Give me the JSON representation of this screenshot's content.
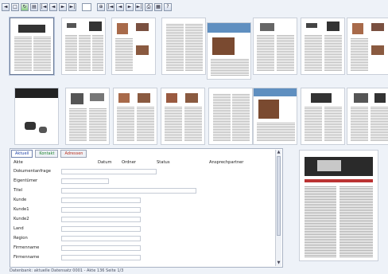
{
  "toolbar": {
    "buttons": [
      {
        "name": "back-icon",
        "glyph": "◄"
      },
      {
        "name": "page-icon",
        "glyph": "□"
      },
      {
        "name": "refresh-icon",
        "glyph": "↻"
      },
      {
        "name": "save-icon",
        "glyph": "▤"
      },
      {
        "name": "first-icon",
        "glyph": "|◄"
      },
      {
        "name": "prev-icon",
        "glyph": "◄"
      },
      {
        "name": "next-icon",
        "glyph": "►"
      },
      {
        "name": "last-icon",
        "glyph": "►|"
      }
    ],
    "buttons2": [
      {
        "name": "zoom-icon",
        "glyph": "⊕"
      },
      {
        "name": "first2-icon",
        "glyph": "|◄"
      },
      {
        "name": "prev2-icon",
        "glyph": "◄"
      },
      {
        "name": "next2-icon",
        "glyph": "►"
      },
      {
        "name": "last2-icon",
        "glyph": "►|"
      },
      {
        "name": "print-icon",
        "glyph": "⎙"
      },
      {
        "name": "grid-icon",
        "glyph": "▦"
      },
      {
        "name": "help-icon",
        "glyph": "?"
      }
    ]
  },
  "tabs": [
    "Aktuell",
    "Kontakt",
    "Adressen"
  ],
  "form": {
    "header_label": "Akte",
    "col_headers": [
      "Datum",
      "Ordner",
      "Status",
      "Ansprechpartner"
    ],
    "rows": [
      "Dokumentanfrage",
      "Eigentümer",
      "Titel",
      "Kunde",
      "Kunde1",
      "Kunde2",
      "Land",
      "Region",
      "Firmenname",
      "Firmenname"
    ]
  },
  "status_text": "Datenbank: aktuelle Datensatz 0001 - Akte 136 Seite 1/3"
}
